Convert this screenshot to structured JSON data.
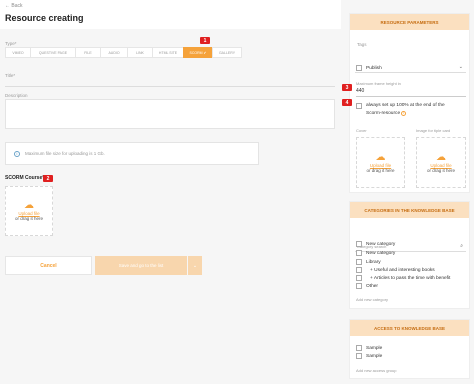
{
  "header": {
    "back": "← Back",
    "title": "Resource creating"
  },
  "form": {
    "type_label": "Type*",
    "type_tabs": [
      "VIMEO",
      "QUESTIVE PAGE",
      "FILE",
      "AUDIO",
      "LINK",
      "HTML SITE",
      "SCORM",
      "GALLERY"
    ],
    "active_type": "SCORM",
    "title_label": "Title*",
    "description_label": "Description",
    "info_text": "Maximum file size for uploading is 1 Gb.",
    "scorm_label": "SCORM Course*",
    "upload_link": "Upload file",
    "upload_or": "or drag it here",
    "cancel": "Cancel",
    "save": "Save and go to the list",
    "badges": {
      "b1": "1",
      "b2": "2",
      "b3": "3",
      "b4": "4"
    }
  },
  "params": {
    "header": "RESOURCE PARAMETERS",
    "tags_placeholder": "Tags",
    "publish": "Publish",
    "frame_label": "Maximum frame height in",
    "frame_value": "440",
    "always_text_1": "always set up 100% at the end of the",
    "always_text_2": "Scorm-resource",
    "cover_label": "Cover",
    "image_label": "Image for tiple card",
    "upload_link": "Upload file",
    "upload_or": "or drag it here"
  },
  "categories": {
    "header": "CATEGORIES IN THE KNOWLEDGE BASE",
    "search_placeholder": "Category search",
    "items": [
      "New category",
      "New category",
      "Library",
      "+ Useful and interesting books",
      "+ Articles to pass the time with benefit",
      "Other"
    ],
    "add": "Add new category"
  },
  "access": {
    "header": "ACCESS TO KNOWLEDGE BASE",
    "items": [
      "Sample",
      "Sample"
    ],
    "add": "Add new access group"
  },
  "colors": {
    "accent": "#f5a23a",
    "badge": "#e02020",
    "panel_head": "#fbe0c0"
  }
}
